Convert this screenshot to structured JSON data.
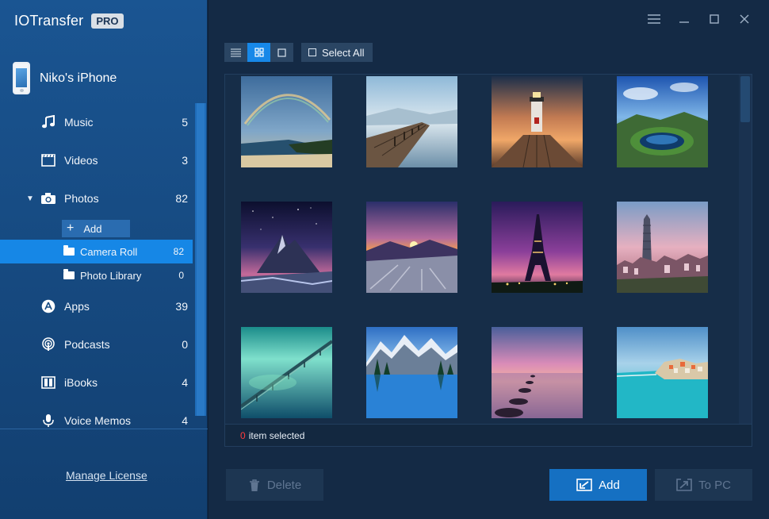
{
  "app": {
    "name": "IOTransfer",
    "badge": "PRO"
  },
  "device": {
    "name": "Niko's iPhone"
  },
  "nav": [
    {
      "label": "Music",
      "count": "5",
      "icon": "music-note-icon"
    },
    {
      "label": "Videos",
      "count": "3",
      "icon": "film-icon"
    },
    {
      "label": "Photos",
      "count": "82",
      "icon": "camera-icon",
      "expanded": true
    },
    {
      "label": "Apps",
      "count": "39",
      "icon": "app-store-icon"
    },
    {
      "label": "Podcasts",
      "count": "0",
      "icon": "podcast-icon"
    },
    {
      "label": "iBooks",
      "count": "4",
      "icon": "book-icon"
    },
    {
      "label": "Voice Memos",
      "count": "4",
      "icon": "microphone-icon"
    }
  ],
  "photos_sub": {
    "add_label": "Add",
    "items": [
      {
        "label": "Camera Roll",
        "count": "82",
        "selected": true
      },
      {
        "label": "Photo Library",
        "count": "0",
        "selected": false
      }
    ]
  },
  "manage_license": "Manage License",
  "toolbar": {
    "select_all": "Select All",
    "view_modes": [
      "list-view-icon",
      "grid-view-icon",
      "large-view-icon"
    ],
    "active_view": "grid-view-icon"
  },
  "window_controls": [
    "menu-icon",
    "minimize-icon",
    "maximize-icon",
    "close-icon"
  ],
  "photos": [
    "rainbow-beach",
    "wooden-pier-fog",
    "lighthouse-sunset",
    "crater-lake-island",
    "mountain-night-sky",
    "sunset-valley",
    "eiffel-tower-dusk",
    "taipei-skyline",
    "ocean-bridge",
    "mountain-lake-reflection",
    "rocks-pink-sunset",
    "coastal-village-turquoise"
  ],
  "status": {
    "count": "0",
    "text": "item selected"
  },
  "actions": {
    "delete": "Delete",
    "add": "Add",
    "to_pc": "To PC"
  },
  "colors": {
    "sidebar": "#174c84",
    "accent": "#1687e6",
    "main_bg": "#142a45",
    "selected_count": "#ff3b3b"
  }
}
